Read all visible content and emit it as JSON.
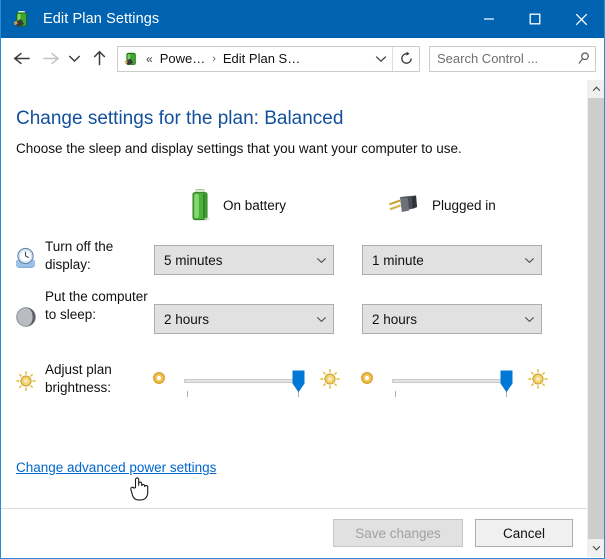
{
  "window": {
    "title": "Edit Plan Settings",
    "icon": "power-plan-battery-icon",
    "accent_color": "#0063b1",
    "border_color": "#2a8dd4",
    "controls": {
      "minimize": "minimize-icon",
      "maximize": "maximize-icon",
      "close": "close-icon"
    }
  },
  "nav": {
    "back": "back-arrow-icon",
    "forward": "forward-arrow-icon",
    "recent": "recent-pages-chevron-icon",
    "up": "up-arrow-icon",
    "address_icon": "power-plan-battery-icon",
    "double_chevron": "«",
    "breadcrumbs": [
      {
        "label": "Powe…"
      },
      {
        "label": "Edit Plan S…"
      }
    ],
    "crumb_separator": "›",
    "dropdown": "chevron-down-icon",
    "refresh": "refresh-icon"
  },
  "search": {
    "value": "",
    "placeholder": "Search Control ...",
    "icon": "search-icon"
  },
  "page": {
    "title": "Change settings for the plan: Balanced",
    "title_color": "#12509c",
    "subtitle": "Choose the sleep and display settings that you want your computer to use.",
    "advanced_link": "Change advanced power settings",
    "link_color": "#0066cc"
  },
  "columns": [
    {
      "key": "on_battery",
      "label": "On battery",
      "icon": "battery-icon"
    },
    {
      "key": "plugged_in",
      "label": "Plugged in",
      "icon": "power-plug-icon"
    }
  ],
  "settings_rows": [
    {
      "icon": "display-clock-icon",
      "label": "Turn off the display:",
      "type": "dropdown",
      "on_battery": {
        "value": "5 minutes"
      },
      "plugged_in": {
        "value": "1 minute"
      }
    },
    {
      "icon": "sleep-moon-icon",
      "label": "Put the computer to sleep:",
      "type": "dropdown",
      "on_battery": {
        "value": "2 hours"
      },
      "plugged_in": {
        "value": "2 hours"
      }
    },
    {
      "icon": "brightness-sun-icon",
      "label": "Adjust plan brightness:",
      "type": "slider",
      "on_battery": {
        "percent": 97,
        "min_icon": "dim-sun-icon",
        "max_icon": "bright-sun-icon"
      },
      "plugged_in": {
        "percent": 97,
        "min_icon": "dim-sun-icon",
        "max_icon": "bright-sun-icon"
      }
    }
  ],
  "footer": {
    "save_label": "Save changes",
    "save_enabled": false,
    "cancel_label": "Cancel",
    "cancel_enabled": true
  },
  "scrollbar": {
    "up_arrow": "chevron-up-icon",
    "down_arrow": "chevron-down-icon",
    "thumb": "scrollbar-thumb"
  },
  "cursor": "hand-pointer-cursor"
}
